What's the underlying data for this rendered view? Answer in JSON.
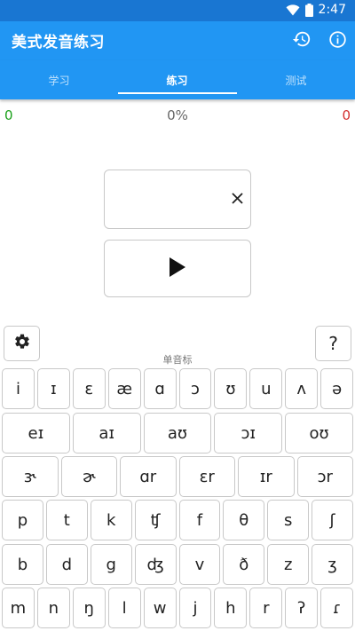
{
  "status": {
    "time": "2:47"
  },
  "app": {
    "title": "美式发音练习"
  },
  "tabs": [
    {
      "label": "学习"
    },
    {
      "label": "练习"
    },
    {
      "label": "测试"
    }
  ],
  "score": {
    "correct": "0",
    "percent": "0%",
    "wrong": "0"
  },
  "section_label": "单音标",
  "help_label": "?",
  "keyboard": {
    "row1": [
      "i",
      "ɪ",
      "ɛ",
      "æ",
      "ɑ",
      "ɔ",
      "ʊ",
      "u",
      "ʌ",
      "ə"
    ],
    "row2": [
      "eɪ",
      "aɪ",
      "aʊ",
      "ɔɪ",
      "oʊ"
    ],
    "row3": [
      "ɝ",
      "ɚ",
      "ɑr",
      "ɛr",
      "ɪr",
      "ɔr"
    ],
    "row4": [
      "p",
      "t",
      "k",
      "ʧ",
      "f",
      "θ",
      "s",
      "ʃ"
    ],
    "row5": [
      "b",
      "d",
      "g",
      "ʤ",
      "v",
      "ð",
      "z",
      "ʒ"
    ],
    "row6": [
      "m",
      "n",
      "ŋ",
      "l",
      "w",
      "j",
      "h",
      "r",
      "ʔ",
      "ɾ"
    ]
  },
  "colors": {
    "primary": "#2196f3",
    "status_bar": "#1976d2",
    "correct": "#1aa01a",
    "wrong": "#d32f2f"
  }
}
